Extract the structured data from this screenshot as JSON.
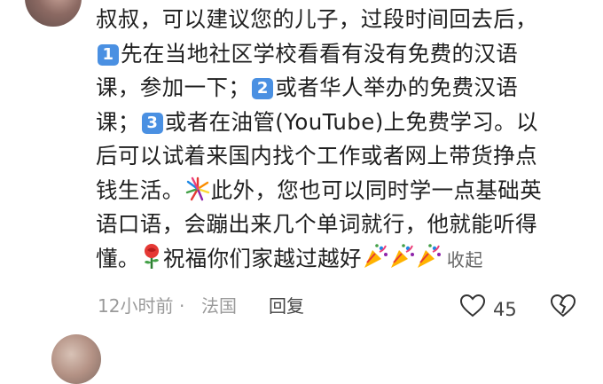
{
  "comment": {
    "line1": "叔叔，可以建议您的儿子，过段时间回去后，",
    "badge1": "1",
    "line2_text": "先在当地社区学校看看有没有免费的汉语",
    "line3_a": "课，参加一下；",
    "badge2": "2",
    "line3_b": "或者华人举办的免费汉语",
    "line4_a": "课；",
    "badge3": "3",
    "line4_b": "或者在油管(YouTube)上免费学习。以",
    "line5": "后可以试着来国内找个工作或者网上带货挣点",
    "line6_a": "钱生活。",
    "line6_b": "此外，您也可以同时学一点基础英",
    "line7": "语口语，会蹦出来几个单词就行，他就能听得",
    "line8_a": "懂。",
    "line8_b": "祝福你们家越过越好",
    "collapse": "收起"
  },
  "meta": {
    "time": "12小时前",
    "dot": "·",
    "location": "法国",
    "reply": "回复",
    "like_count": "45"
  },
  "icons": {
    "badge_color": "#4a90e2",
    "fireworks": "fireworks-icon",
    "rose": "rose-icon",
    "party": "party-popper-icon",
    "like": "heart-outline-icon",
    "dislike": "broken-heart-icon"
  }
}
